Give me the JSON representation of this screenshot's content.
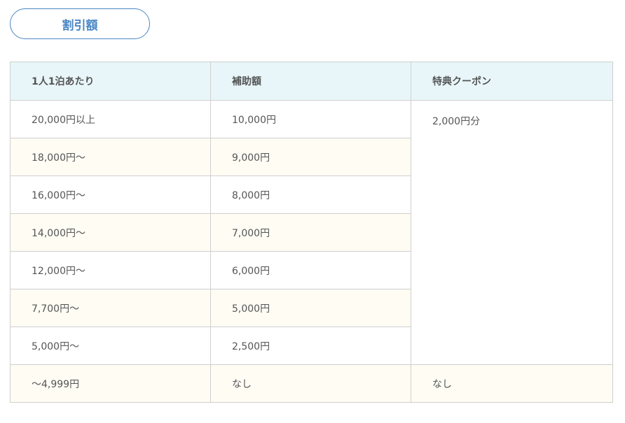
{
  "discount_button": {
    "label": "割引額"
  },
  "table": {
    "headers": [
      "1人1泊あたり",
      "補助額",
      "特典クーポン"
    ],
    "rows": [
      {
        "per_night": "20,000円以上",
        "subsidy": "10,000円"
      },
      {
        "per_night": "18,000円〜",
        "subsidy": "9,000円"
      },
      {
        "per_night": "16,000円〜",
        "subsidy": "8,000円"
      },
      {
        "per_night": "14,000円〜",
        "subsidy": "7,000円"
      },
      {
        "per_night": "12,000円〜",
        "subsidy": "6,000円"
      },
      {
        "per_night": "7,700円〜",
        "subsidy": "5,000円"
      },
      {
        "per_night": "5,000円〜",
        "subsidy": "2,500円"
      }
    ],
    "coupon_merged": "2,000円分",
    "last_row": {
      "per_night": "〜4,999円",
      "subsidy": "なし",
      "coupon": "なし"
    }
  }
}
